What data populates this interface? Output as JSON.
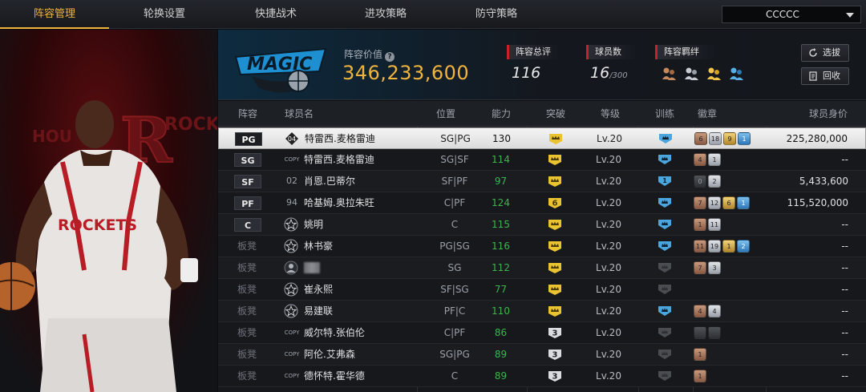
{
  "nav": {
    "tabs": [
      "阵容管理",
      "轮换设置",
      "快捷战术",
      "进攻策略",
      "防守策略"
    ],
    "active_tab": 0,
    "dropdown_value": "CCCCC"
  },
  "header": {
    "team_value_label": "阵容价值",
    "team_value": "346,233,600",
    "overall_label": "阵容总评",
    "overall_value": "116",
    "players_label": "球员数",
    "players_value": "16",
    "players_max": "/300",
    "bonds_label": "阵容羁绊",
    "bond_icons": [
      "bond-icon-bronze",
      "bond-icon-silver",
      "bond-icon-gold",
      "bond-icon-blue"
    ],
    "btn_select": "选拔",
    "btn_recycle": "回收"
  },
  "table": {
    "columns": [
      "阵容",
      "球员名",
      "位置",
      "能力",
      "突破",
      "等级",
      "训练",
      "徽章",
      "球员身价"
    ],
    "rows": [
      {
        "slot": "PG",
        "bench": false,
        "badge": "04",
        "name": "特雷西.麦格雷迪",
        "position": "SG|PG",
        "rating": "130",
        "breakthrough": "crown-gold",
        "level": "Lv.20",
        "train": "blue",
        "medals": [
          [
            "6",
            "bronze"
          ],
          [
            "18",
            "silver"
          ],
          [
            "9",
            "gold"
          ],
          [
            "1",
            "blue"
          ]
        ],
        "price": "225,280,000",
        "selected": true
      },
      {
        "slot": "SG",
        "bench": false,
        "badge": "COPY",
        "name": "特雷西.麦格雷迪",
        "position": "SG|SF",
        "rating": "114",
        "breakthrough": "crown-gold",
        "level": "Lv.20",
        "train": "blue",
        "medals": [
          [
            "4",
            "bronze"
          ],
          [
            "1",
            "silver"
          ]
        ],
        "price": "--"
      },
      {
        "slot": "SF",
        "bench": false,
        "badge": "02",
        "name": "肖恩.巴蒂尔",
        "position": "SF|PF",
        "rating": "97",
        "breakthrough": "crown-gold",
        "level": "Lv.20",
        "train": "blue1",
        "medals": [
          [
            "0",
            "dark"
          ],
          [
            "2",
            "silver"
          ]
        ],
        "price": "5,433,600"
      },
      {
        "slot": "PF",
        "bench": false,
        "badge": "94",
        "name": "哈基姆.奥拉朱旺",
        "position": "C|PF",
        "rating": "124",
        "breakthrough": "gold-6",
        "level": "Lv.20",
        "train": "blue",
        "medals": [
          [
            "7",
            "bronze"
          ],
          [
            "12",
            "silver"
          ],
          [
            "6",
            "gold"
          ],
          [
            "1",
            "blue"
          ]
        ],
        "price": "115,520,000"
      },
      {
        "slot": "C",
        "bench": false,
        "badge": "star",
        "name": "姚明",
        "position": "C",
        "rating": "115",
        "breakthrough": "crown-gold",
        "level": "Lv.20",
        "train": "blue",
        "medals": [
          [
            "1",
            "bronze"
          ],
          [
            "11",
            "silver"
          ]
        ],
        "price": "--"
      },
      {
        "slot": "板凳",
        "bench": true,
        "badge": "star",
        "name": "林书豪",
        "position": "PG|SG",
        "rating": "116",
        "breakthrough": "crown-gold",
        "level": "Lv.20",
        "train": "blue",
        "medals": [
          [
            "11",
            "bronze"
          ],
          [
            "19",
            "silver"
          ],
          [
            "1",
            "gold"
          ],
          [
            "2",
            "blue"
          ]
        ],
        "price": "--"
      },
      {
        "slot": "板凳",
        "bench": true,
        "badge": "person",
        "name": "",
        "position": "SG",
        "rating": "112",
        "breakthrough": "crown-gold",
        "level": "Lv.20",
        "train": "dark",
        "medals": [
          [
            "7",
            "bronze"
          ],
          [
            "3",
            "silver"
          ]
        ],
        "price": "--"
      },
      {
        "slot": "板凳",
        "bench": true,
        "badge": "star",
        "name": "崔永熙",
        "position": "SF|SG",
        "rating": "77",
        "breakthrough": "crown-gold",
        "level": "Lv.20",
        "train": "dark",
        "medals": [],
        "price": "--"
      },
      {
        "slot": "板凳",
        "bench": true,
        "badge": "star",
        "name": "易建联",
        "position": "PF|C",
        "rating": "110",
        "breakthrough": "crown-gold",
        "level": "Lv.20",
        "train": "blue",
        "medals": [
          [
            "4",
            "bronze"
          ],
          [
            "4",
            "silver"
          ]
        ],
        "price": "--"
      },
      {
        "slot": "板凳",
        "bench": true,
        "badge": "COPY",
        "name": "威尔特.张伯伦",
        "position": "C|PF",
        "rating": "86",
        "breakthrough": "silver-3",
        "level": "Lv.20",
        "train": "dark",
        "medals": [
          [
            "",
            "dark"
          ],
          [
            "",
            "dark"
          ]
        ],
        "price": "--"
      },
      {
        "slot": "板凳",
        "bench": true,
        "badge": "COPY",
        "name": "阿伦.艾弗森",
        "position": "SG|PG",
        "rating": "89",
        "breakthrough": "silver-3",
        "level": "Lv.20",
        "train": "dark",
        "medals": [
          [
            "1",
            "bronze"
          ]
        ],
        "price": "--"
      },
      {
        "slot": "板凳",
        "bench": true,
        "badge": "COPY",
        "name": "德怀特.霍华德",
        "position": "C",
        "rating": "89",
        "breakthrough": "silver-3",
        "level": "Lv.20",
        "train": "dark",
        "medals": [
          [
            "1",
            "bronze"
          ]
        ],
        "price": "--"
      }
    ]
  }
}
